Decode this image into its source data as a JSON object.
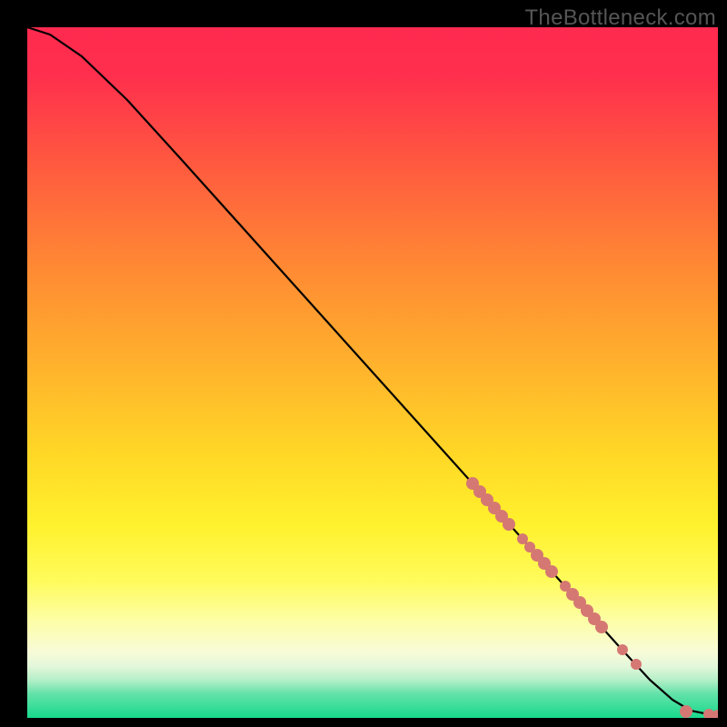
{
  "watermark": "TheBottleneck.com",
  "chart_data": {
    "type": "line",
    "title": "",
    "xlabel": "",
    "ylabel": "",
    "xlim": [
      30,
      790
    ],
    "ylim": [
      30,
      790
    ],
    "gradient_stops": [
      {
        "offset": 0.0,
        "color": "#ff2a4f"
      },
      {
        "offset": 0.07,
        "color": "#ff2f4d"
      },
      {
        "offset": 0.2,
        "color": "#ff5a3f"
      },
      {
        "offset": 0.35,
        "color": "#ff8a33"
      },
      {
        "offset": 0.5,
        "color": "#ffb52c"
      },
      {
        "offset": 0.62,
        "color": "#ffd826"
      },
      {
        "offset": 0.72,
        "color": "#fff12d"
      },
      {
        "offset": 0.8,
        "color": "#fffb5a"
      },
      {
        "offset": 0.86,
        "color": "#fdfea7"
      },
      {
        "offset": 0.905,
        "color": "#f7fbd8"
      },
      {
        "offset": 0.925,
        "color": "#e3f7da"
      },
      {
        "offset": 0.945,
        "color": "#b5efc8"
      },
      {
        "offset": 0.965,
        "color": "#63e2a9"
      },
      {
        "offset": 1.0,
        "color": "#17d98c"
      }
    ],
    "curve": [
      {
        "x": 30,
        "y": 30
      },
      {
        "x": 55,
        "y": 38
      },
      {
        "x": 90,
        "y": 62
      },
      {
        "x": 140,
        "y": 110
      },
      {
        "x": 200,
        "y": 176
      },
      {
        "x": 280,
        "y": 265
      },
      {
        "x": 360,
        "y": 354
      },
      {
        "x": 440,
        "y": 443
      },
      {
        "x": 520,
        "y": 532
      },
      {
        "x": 600,
        "y": 621
      },
      {
        "x": 680,
        "y": 710
      },
      {
        "x": 715,
        "y": 748
      },
      {
        "x": 740,
        "y": 770
      },
      {
        "x": 760,
        "y": 782
      },
      {
        "x": 790,
        "y": 788
      }
    ],
    "markers": [
      {
        "x": 520,
        "y": 532,
        "r": 7
      },
      {
        "x": 528,
        "y": 541,
        "r": 7
      },
      {
        "x": 536,
        "y": 550,
        "r": 7
      },
      {
        "x": 544,
        "y": 559,
        "r": 7
      },
      {
        "x": 552,
        "y": 568,
        "r": 7
      },
      {
        "x": 560,
        "y": 577,
        "r": 7
      },
      {
        "x": 575,
        "y": 593,
        "r": 6
      },
      {
        "x": 583,
        "y": 602,
        "r": 6
      },
      {
        "x": 591,
        "y": 611,
        "r": 7
      },
      {
        "x": 599,
        "y": 620,
        "r": 7
      },
      {
        "x": 607,
        "y": 629,
        "r": 7
      },
      {
        "x": 622,
        "y": 645,
        "r": 6
      },
      {
        "x": 630,
        "y": 654,
        "r": 7
      },
      {
        "x": 638,
        "y": 663,
        "r": 7
      },
      {
        "x": 646,
        "y": 672,
        "r": 7
      },
      {
        "x": 654,
        "y": 681,
        "r": 7
      },
      {
        "x": 662,
        "y": 690,
        "r": 7
      },
      {
        "x": 685,
        "y": 715,
        "r": 6
      },
      {
        "x": 700,
        "y": 731,
        "r": 6
      },
      {
        "x": 755,
        "y": 783,
        "r": 7
      },
      {
        "x": 780,
        "y": 786,
        "r": 6
      },
      {
        "x": 790,
        "y": 788,
        "r": 7
      }
    ],
    "marker_color": "#d57873",
    "curve_color": "#000000",
    "curve_width": 2.2
  }
}
